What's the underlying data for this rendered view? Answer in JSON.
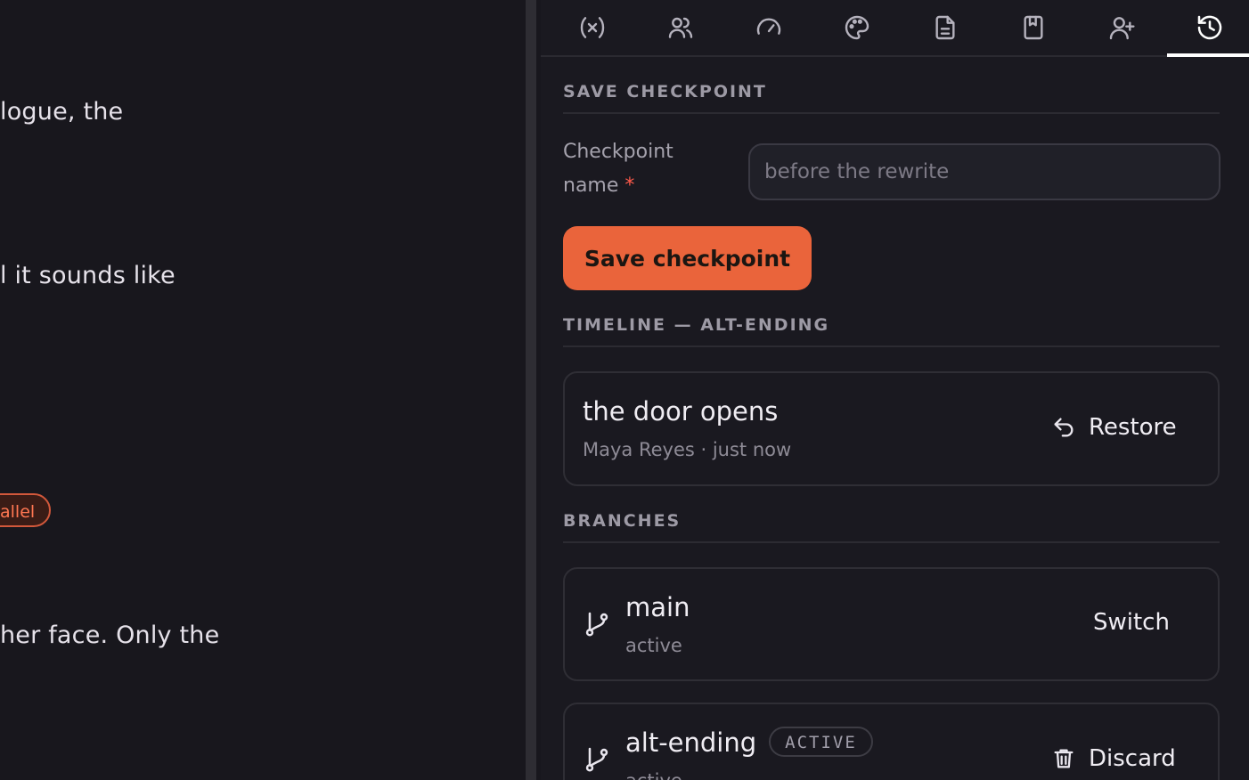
{
  "editor": {
    "lines": [
      {
        "text": "logue, the"
      },
      {
        "text": "l it sounds like"
      },
      {
        "text": "her face. Only the"
      }
    ],
    "chip": "allel"
  },
  "panel": {
    "tabs": [
      {
        "icon": "variable-icon"
      },
      {
        "icon": "users-icon"
      },
      {
        "icon": "gauge-icon"
      },
      {
        "icon": "palette-icon"
      },
      {
        "icon": "document-icon"
      },
      {
        "icon": "bookmark-book-icon"
      },
      {
        "icon": "user-plus-icon"
      },
      {
        "icon": "history-icon",
        "active": true
      }
    ],
    "save_section": {
      "title": "SAVE CHECKPOINT",
      "label_line1": "Checkpoint",
      "label_line2": "name",
      "required_mark": "*",
      "input_value": "",
      "input_placeholder": "before the rewrite",
      "button_label": "Save checkpoint"
    },
    "timeline": {
      "title": "TIMELINE — ALT-ENDING",
      "entries": [
        {
          "title": "the door opens",
          "meta": "Maya Reyes · just now",
          "action": "Restore"
        }
      ]
    },
    "branches": {
      "title": "BRANCHES",
      "items": [
        {
          "name": "main",
          "status": "active",
          "action": "Switch"
        },
        {
          "name": "alt-ending",
          "badge": "ACTIVE",
          "status": "active",
          "action": "Discard"
        }
      ]
    }
  },
  "colors": {
    "accent": "#ea643b",
    "background": "#18171d",
    "panel": "#1a1920",
    "chip": "#ff7752"
  }
}
